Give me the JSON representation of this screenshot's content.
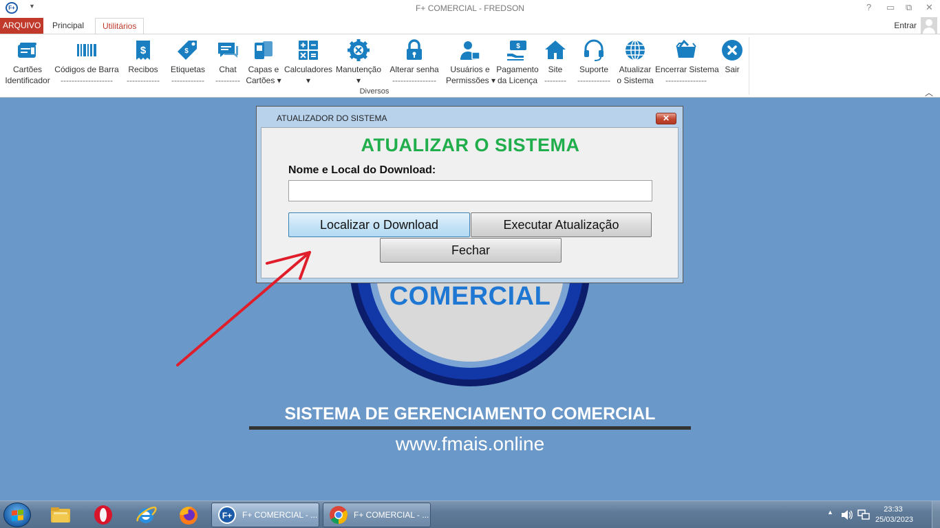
{
  "window": {
    "app_icon": "F+",
    "title": "F+ COMERCIAL - FREDSON",
    "controls": [
      "?",
      "▭",
      "⧉",
      "✕"
    ]
  },
  "tabs": {
    "file": "ARQUIVO",
    "principal": "Principal",
    "active": "Utilitários",
    "signin": "Entrar"
  },
  "ribbon": {
    "group_label": "Diversos",
    "buttons": [
      {
        "label1": "Cartões",
        "label2": "Identificador",
        "icon": "id-card-icon"
      },
      {
        "label1": "Códigos de Barra",
        "label2": "-------------------",
        "icon": "barcode-icon"
      },
      {
        "label1": "Recibos",
        "label2": "------------",
        "icon": "receipt-icon"
      },
      {
        "label1": "Etiquetas",
        "label2": "------------",
        "icon": "tag-icon"
      },
      {
        "label1": "Chat",
        "label2": "---------",
        "icon": "chat-icon"
      },
      {
        "label1": "Capas e",
        "label2": "Cartões ▾",
        "icon": "cards-icon"
      },
      {
        "label1": "Calculadores",
        "label2": "▾",
        "icon": "calculator-icon"
      },
      {
        "label1": "Manutenção",
        "label2": "▾",
        "icon": "maintenance-icon"
      },
      {
        "label1": "Alterar senha",
        "label2": "----------------",
        "icon": "lock-icon"
      },
      {
        "label1": "Usuários e",
        "label2": "Permissões ▾",
        "icon": "users-icon"
      },
      {
        "label1": "Pagamento",
        "label2": "da Licença",
        "icon": "payment-icon"
      },
      {
        "label1": "Site",
        "label2": "--------",
        "icon": "home-icon"
      },
      {
        "label1": "Suporte",
        "label2": "------------",
        "icon": "headset-icon"
      },
      {
        "label1": "Atualizar",
        "label2": "o Sistema",
        "icon": "globe-icon"
      },
      {
        "label1": "Encerrar Sistema",
        "label2": "---------------",
        "icon": "box-icon"
      },
      {
        "label1": "Sair",
        "label2": "",
        "icon": "close-circle-icon"
      }
    ]
  },
  "background": {
    "logo_text": "COMERCIAL",
    "tagline": "SISTEMA DE GERENCIAMENTO COMERCIAL",
    "website": "www.fmais.online"
  },
  "dialog": {
    "title": "ATUALIZADOR DO SISTEMA",
    "close_label": "✕",
    "heading": "ATUALIZAR O SISTEMA",
    "field_label": "Nome e Local do Download:",
    "field_value": "",
    "btn_locate": "Localizar o Download",
    "btn_execute": "Executar Atualização",
    "btn_close": "Fechar"
  },
  "taskbar": {
    "tasks": [
      {
        "label": "F+ COMERCIAL - ...",
        "icon": "fplus-app-icon"
      },
      {
        "label": "F+ COMERCIAL - ...",
        "icon": "chrome-icon"
      }
    ],
    "time": "23:33",
    "date": "25/03/2023"
  },
  "colors": {
    "accent_red": "#c0392b",
    "ribbon_icon": "#1a7fc1",
    "dialog_heading": "#1fae4b",
    "desktop_bg": "#6a98c8"
  }
}
